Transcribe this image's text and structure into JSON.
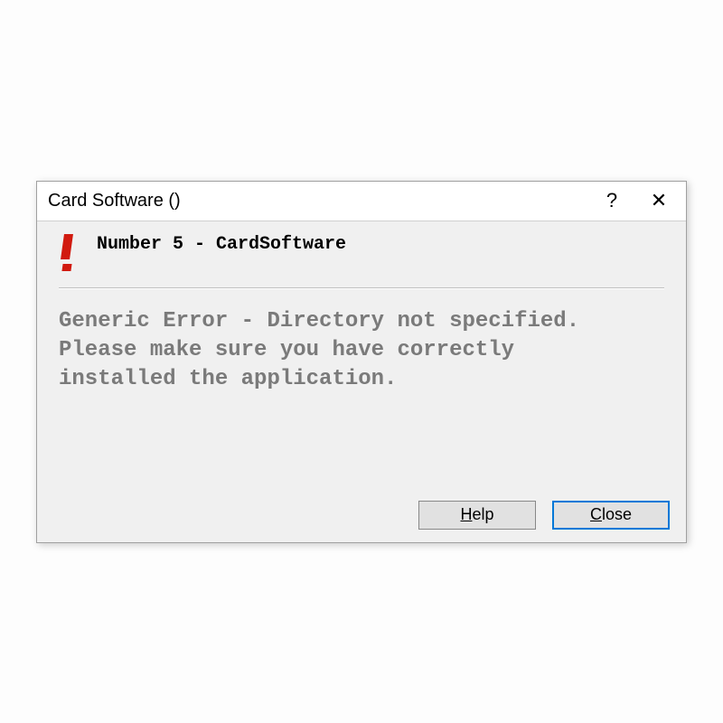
{
  "titlebar": {
    "title": "Card Software ()"
  },
  "header": {
    "label": "Number 5 - CardSoftware"
  },
  "body": {
    "message": "Generic Error - Directory not specified.\nPlease make sure you have correctly\ninstalled the application."
  },
  "buttons": {
    "help": "Help",
    "close": "Close"
  }
}
